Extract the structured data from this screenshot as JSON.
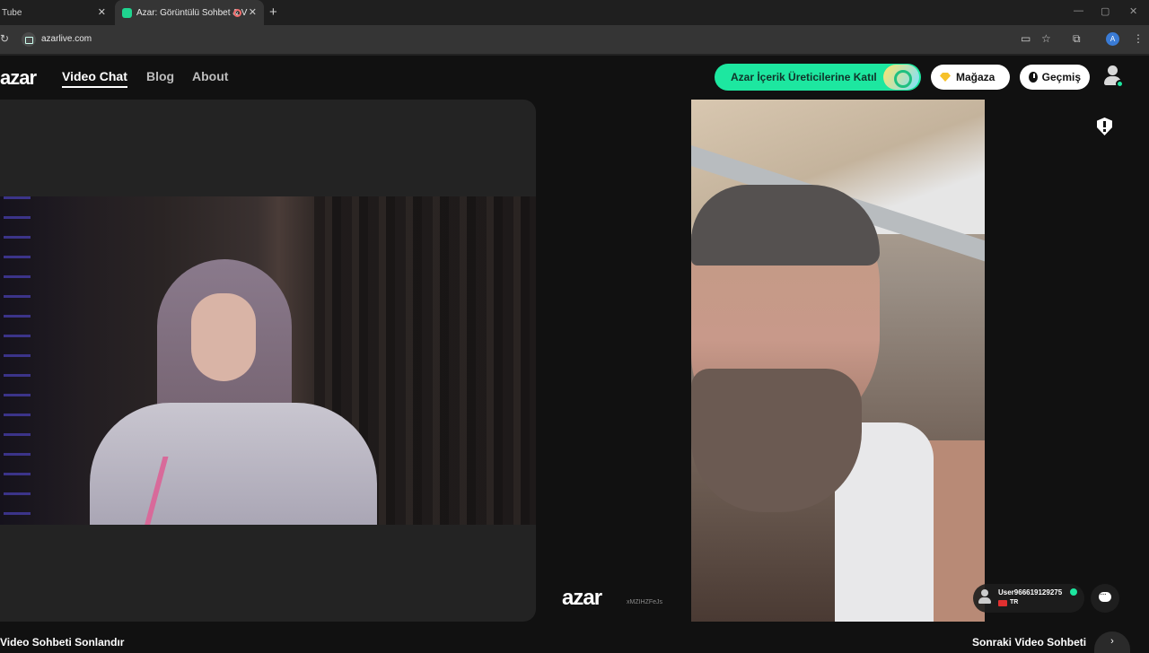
{
  "browser": {
    "tabs": [
      {
        "title": "Tube"
      },
      {
        "title": "Azar: Görüntülü Sohbet & V"
      }
    ],
    "new_tab": "+",
    "url": "azarlive.com",
    "profile_initial": "A",
    "window_controls": {
      "minimize": "—",
      "restore": "▢",
      "close": "✕"
    }
  },
  "site": {
    "logo": "azar",
    "nav": [
      {
        "label": "Video Chat",
        "active": true
      },
      {
        "label": "Blog",
        "active": false
      },
      {
        "label": "About",
        "active": false
      }
    ],
    "creator_button": "Azar İçerik Üreticilerine Katıl",
    "store_button": "Mağaza",
    "history_button": "Geçmiş",
    "accent_color": "#1de7a0"
  },
  "call": {
    "watermark_logo": "azar",
    "watermark_id": "xMZIHZFeJs",
    "peer": {
      "name": "User966619129275",
      "country": "TR"
    },
    "end_label": "Video Sohbeti Sonlandır",
    "next_label": "Sonraki Video Sohbeti",
    "next_arrow": "›"
  }
}
